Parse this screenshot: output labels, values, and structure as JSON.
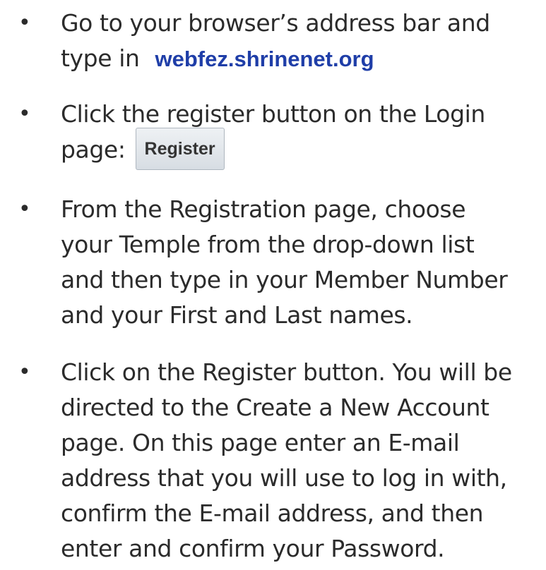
{
  "bullet_glyph": "•",
  "steps": [
    {
      "lines": [
        "Go to your browser’s address bar and",
        "type in"
      ],
      "url": "webfez.shrinenet.org"
    },
    {
      "lines": [
        "Click the register button on the Login",
        "page:"
      ],
      "button_label": "Register"
    },
    {
      "lines": [
        "From the Registration page, choose",
        "your Temple from the drop-down list",
        "and then type in your Member Number",
        "and your First and Last names."
      ]
    },
    {
      "lines": [
        "Click on the Register button. You will be",
        "directed to the Create a New Account",
        "page. On this page enter an E-mail",
        "address that you will use to log in with,",
        "confirm the E-mail address, and then",
        "enter and confirm your Password."
      ]
    }
  ],
  "colors": {
    "text": "#2b2b2b",
    "url": "#1f3ea8",
    "button_bg": "#dfe4ea"
  }
}
